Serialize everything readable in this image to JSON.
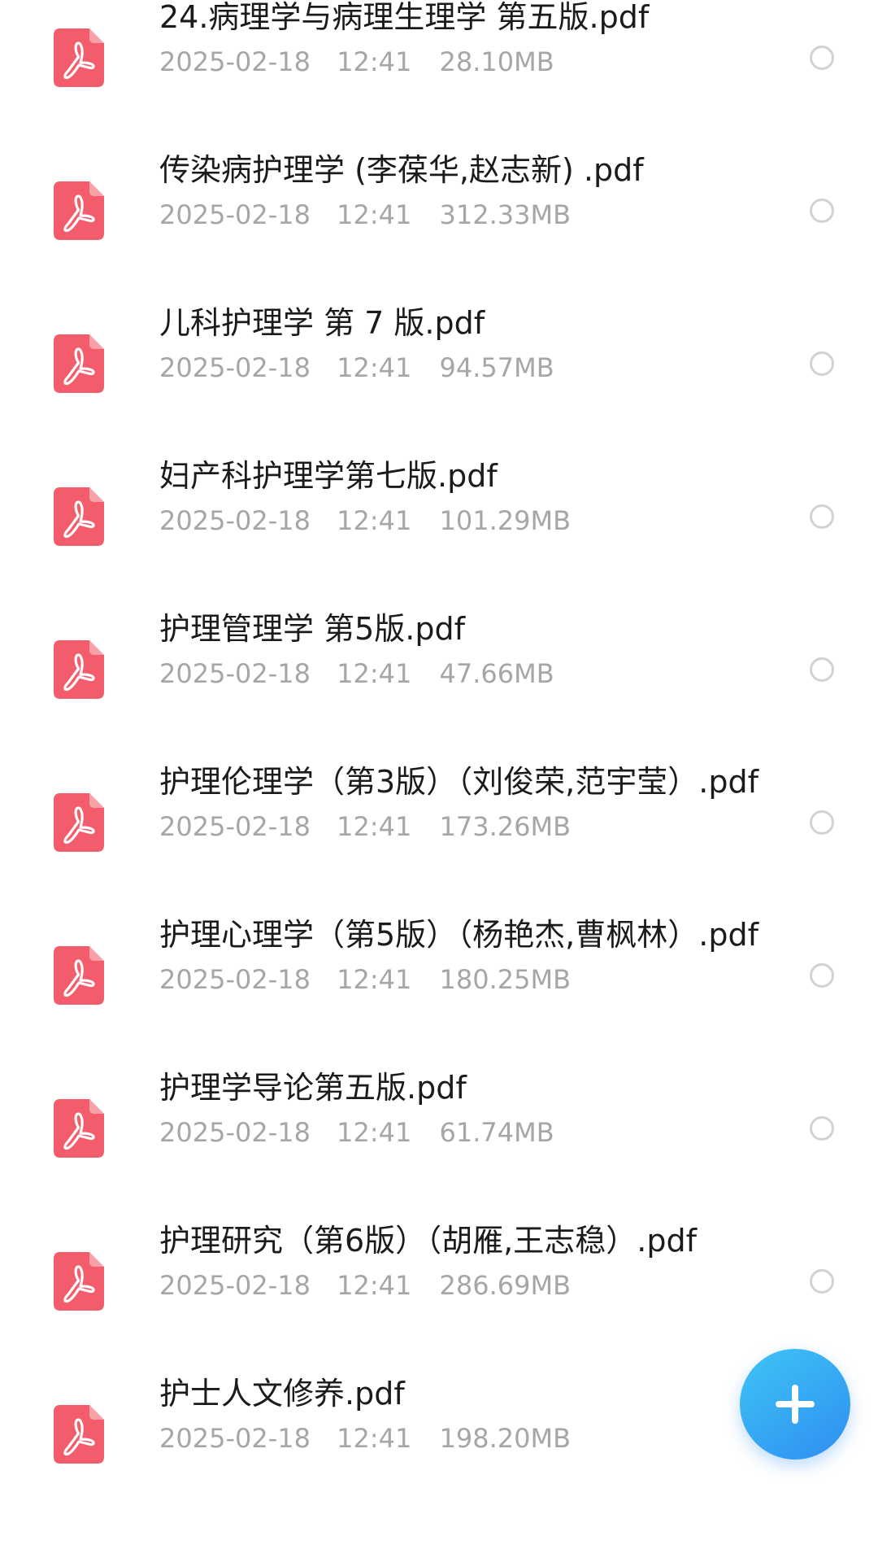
{
  "files": [
    {
      "name": "24.病理学与病理生理学 第五版.pdf",
      "date": "2025-02-18",
      "time": "12:41",
      "size": "28.10MB",
      "icon": "pdf-file-icon"
    },
    {
      "name": "传染病护理学 (李葆华,赵志新) .pdf",
      "date": "2025-02-18",
      "time": "12:41",
      "size": "312.33MB",
      "icon": "pdf-file-icon"
    },
    {
      "name": "儿科护理学 第 7 版.pdf",
      "date": "2025-02-18",
      "time": "12:41",
      "size": "94.57MB",
      "icon": "pdf-file-icon"
    },
    {
      "name": "妇产科护理学第七版.pdf",
      "date": "2025-02-18",
      "time": "12:41",
      "size": "101.29MB",
      "icon": "pdf-file-icon"
    },
    {
      "name": "护理管理学 第5版.pdf",
      "date": "2025-02-18",
      "time": "12:41",
      "size": "47.66MB",
      "icon": "pdf-file-icon"
    },
    {
      "name": "护理伦理学（第3版）（刘俊荣,范宇莹）.pdf",
      "date": "2025-02-18",
      "time": "12:41",
      "size": "173.26MB",
      "icon": "pdf-file-icon"
    },
    {
      "name": "护理心理学（第5版）（杨艳杰,曹枫林）.pdf",
      "date": "2025-02-18",
      "time": "12:41",
      "size": "180.25MB",
      "icon": "pdf-file-icon"
    },
    {
      "name": "护理学导论第五版.pdf",
      "date": "2025-02-18",
      "time": "12:41",
      "size": "61.74MB",
      "icon": "pdf-file-icon"
    },
    {
      "name": "护理研究（第6版）（胡雁,王志稳）.pdf",
      "date": "2025-02-18",
      "time": "12:41",
      "size": "286.69MB",
      "icon": "pdf-file-icon"
    },
    {
      "name": "护士人文修养.pdf",
      "date": "2025-02-18",
      "time": "12:41",
      "size": "198.20MB",
      "icon": "pdf-file-icon"
    }
  ],
  "fab": {
    "icon": "plus-icon"
  },
  "colors": {
    "pdf_icon": "#f35d6b",
    "title_text": "#1b1b1b",
    "meta_text": "#a6a6a6",
    "radio_border": "#d2d2d2",
    "fab_start": "#3fc4f7",
    "fab_end": "#2f8ef0"
  }
}
